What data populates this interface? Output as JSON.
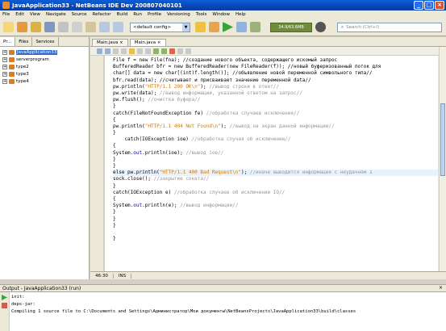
{
  "window": {
    "title": "JavaApplication33 - NetBeans IDE Dev 200807040101"
  },
  "menu": [
    "File",
    "Edit",
    "View",
    "Navigate",
    "Source",
    "Refactor",
    "Build",
    "Run",
    "Profile",
    "Versioning",
    "Tools",
    "Window",
    "Help"
  ],
  "toolbar": {
    "config": "<default config>",
    "memory": "34.9/63.6MB",
    "search_placeholder": "Search (Ctrl+I)"
  },
  "left_panel": {
    "tabs": [
      "Pr...",
      "Files",
      "Services"
    ],
    "tree": [
      {
        "label": "JavaApplication33",
        "selected": true
      },
      {
        "label": "serverprogram",
        "selected": false
      },
      {
        "label": "type2",
        "selected": false
      },
      {
        "label": "type3",
        "selected": false
      },
      {
        "label": "type4",
        "selected": false
      }
    ]
  },
  "editor": {
    "tabs": [
      "Main.java",
      "Main.java"
    ],
    "lines": [
      [
        {
          "t": "File f = new File(fna); //создание нового объекта, содержащего искомый запрос"
        }
      ],
      [
        {
          "t": "BufferedReader bfr = new BufferedReader(new FileReader(f)); //новый буферизованный поток для"
        }
      ],
      [
        {
          "t": "char[] data = new char[(int)f.length()]; //объявление новой переменной символьного типа//"
        }
      ],
      [
        {
          "t": "bfr.read(data); //считывает и присваивает значение переменной data//"
        }
      ],
      [
        {
          "t": "pw.println("
        },
        {
          "t": "\"HTTP/1.1 200 OK\\n\"",
          "c": "str"
        },
        {
          "t": "); "
        },
        {
          "t": "//вывод строки в ответ//",
          "c": "cmt"
        }
      ],
      [
        {
          "t": "pw.write(data); "
        },
        {
          "t": "//вывод информации, указанной ответом на запрос//",
          "c": "cmt"
        }
      ],
      [
        {
          "t": "pw.flush(); "
        },
        {
          "t": "//очистка буфера//",
          "c": "cmt"
        }
      ],
      [
        {
          "t": "}"
        }
      ],
      [
        {
          "t": "catch(FileNotFoundException fe) "
        },
        {
          "t": "//обработка случаев исключения//",
          "c": "cmt"
        }
      ],
      [
        {
          "t": "{"
        }
      ],
      [
        {
          "t": "pw.println("
        },
        {
          "t": "\"HTTP/1.1 404 Not Found\\n\"",
          "c": "str"
        },
        {
          "t": "); "
        },
        {
          "t": "//вывод на экран данной информации//",
          "c": "cmt"
        }
      ],
      [
        {
          "t": "}"
        }
      ],
      [
        {
          "t": "    catch(IOException ioe) "
        },
        {
          "t": "//обработка случая об исключении//",
          "c": "cmt"
        }
      ],
      [
        {
          "t": "{"
        }
      ],
      [
        {
          "t": "System."
        },
        {
          "t": "out",
          "c": "kw"
        },
        {
          "t": ".println(ioe); "
        },
        {
          "t": "//вывод ioe//",
          "c": "cmt"
        }
      ],
      [
        {
          "t": "}"
        }
      ],
      [
        {
          "t": "}"
        }
      ],
      [
        {
          "t": "else pw.println("
        },
        {
          "t": "\"HTTP/1.1 400 Bad Request\\n\"",
          "c": "str"
        },
        {
          "t": "); "
        },
        {
          "t": "//иначе выводится информация с неудачном з",
          "c": "cmt"
        }
      ],
      [
        {
          "t": "sock.close(); "
        },
        {
          "t": "//закрытие сокета//",
          "c": "cmt"
        }
      ],
      [
        {
          "t": "}"
        }
      ],
      [
        {
          "t": "catch(IOException e) "
        },
        {
          "t": "//обработка случаев об исключении IO//",
          "c": "cmt"
        }
      ],
      [
        {
          "t": "{"
        }
      ],
      [
        {
          "t": "System."
        },
        {
          "t": "out",
          "c": "kw"
        },
        {
          "t": ".println(e); "
        },
        {
          "t": "//вывод информации//",
          "c": "cmt"
        }
      ],
      [
        {
          "t": "}"
        }
      ],
      [
        {
          "t": "}"
        }
      ],
      [
        {
          "t": "}"
        }
      ],
      [
        {
          "t": ""
        }
      ],
      [
        {
          "t": "}"
        }
      ],
      [
        {
          "t": ""
        }
      ]
    ]
  },
  "status": {
    "position": "46:30",
    "mode": "INS"
  },
  "output": {
    "title": "Output - JavaApplication33 (run)",
    "lines": [
      "init:",
      "deps-jar:",
      "Compiling 1 source file to C:\\Documents and Settings\\Администратор\\Мои документы\\NetBeansProjects\\JavaApplication33\\build\\classes"
    ]
  },
  "colors": {
    "title_bar": "#0b47b8",
    "string": "#ce7b00",
    "comment": "#969696",
    "keyword": "#0000e6",
    "project_icon": "#e07a1f"
  }
}
